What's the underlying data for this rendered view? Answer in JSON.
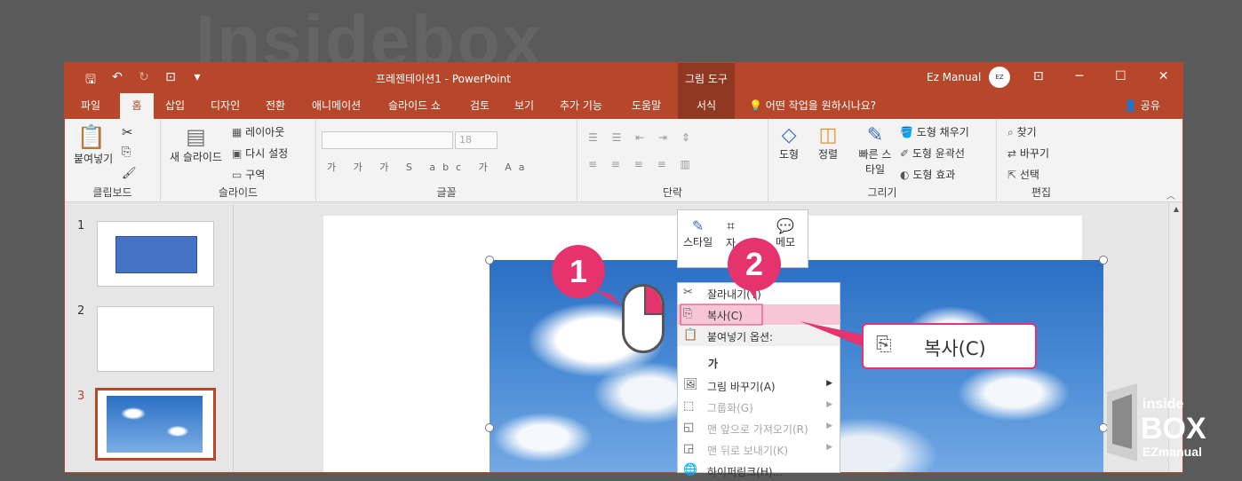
{
  "titlebar": {
    "document_title": "프레젠테이션1  -  PowerPoint",
    "tool_context": "그림 도구",
    "user": "Ez Manual"
  },
  "tabs": [
    "파일",
    "홈",
    "삽입",
    "디자인",
    "전환",
    "애니메이션",
    "슬라이드 쇼",
    "검토",
    "보기",
    "추가 기능",
    "도움말",
    "서식"
  ],
  "active_tab": "홈",
  "tell_me": "어떤 작업을 원하시나요?",
  "share": "공유",
  "ribbon": {
    "clipboard": {
      "label": "클립보드",
      "paste": "붙여넣기"
    },
    "slides": {
      "label": "슬라이드",
      "new_slide": "새 슬라이드",
      "layout": "레이아웃",
      "reset": "다시 설정",
      "section": "구역"
    },
    "font": {
      "label": "글꼴",
      "size_placeholder": "18",
      "format_row": "가 가 가 S abc 가 Aa"
    },
    "paragraph": {
      "label": "단락"
    },
    "drawing": {
      "label": "그리기",
      "shapes": "도형",
      "arrange": "정렬",
      "quick_styles": "빠른 스타일",
      "fill": "도형 채우기",
      "outline": "도형 윤곽선",
      "effects": "도형 효과"
    },
    "editing": {
      "label": "편집",
      "find": "찾기",
      "replace": "바꾸기",
      "select": "선택"
    }
  },
  "slides": [
    {
      "number": "1",
      "content": "blue rectangle"
    },
    {
      "number": "2",
      "content": "blank"
    },
    {
      "number": "3",
      "content": "sky picture",
      "selected": true
    }
  ],
  "mini_toolbar": {
    "style": "스타일",
    "crop": "자",
    "comment": "메모"
  },
  "context_menu": [
    {
      "label": "잘라내기(T)",
      "icon": "scissors-icon",
      "enabled": true
    },
    {
      "label": "복사(C)",
      "icon": "copy-icon",
      "enabled": true,
      "highlighted": true
    },
    {
      "label": "붙여넣기 옵션:",
      "icon": "paste-icon",
      "enabled": true,
      "header": true
    },
    {
      "label": "가",
      "icon": "paste-text-icon",
      "enabled": true
    },
    {
      "label": "그림 바꾸기(A)",
      "icon": "change-picture-icon",
      "enabled": true,
      "submenu": true
    },
    {
      "label": "그룹화(G)",
      "icon": "group-icon",
      "enabled": false,
      "submenu": true
    },
    {
      "label": "맨 앞으로 가져오기(R)",
      "icon": "bring-front-icon",
      "enabled": false,
      "submenu": true
    },
    {
      "label": "맨 뒤로 보내기(K)",
      "icon": "send-back-icon",
      "enabled": false,
      "submenu": true
    },
    {
      "label": "하이퍼링크(H)...",
      "icon": "link-icon",
      "enabled": true
    }
  ],
  "annotations": {
    "step1": "1",
    "step2": "2",
    "callout": "복사(C)"
  },
  "watermark": {
    "text": "Insidebox",
    "logo_top": "inside",
    "logo_mid": "BOX",
    "logo_bottom": "EZmanual"
  },
  "colors": {
    "accent": "#b7472a",
    "highlight": "#e4336d"
  }
}
